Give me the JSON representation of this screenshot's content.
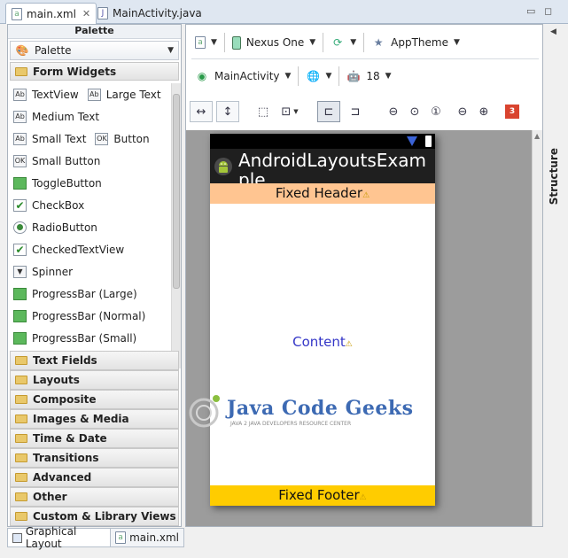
{
  "editor_tabs": [
    {
      "label": "main.xml",
      "active": true
    },
    {
      "label": "MainActivity.java",
      "active": false
    }
  ],
  "palette": {
    "header": "Palette",
    "selector": "Palette",
    "open_category": "Form Widgets",
    "widgets": [
      [
        "TextView",
        "Large Text"
      ],
      [
        "Medium Text"
      ],
      [
        "Small Text",
        "Button"
      ],
      [
        "Small Button"
      ],
      [
        "ToggleButton"
      ],
      [
        "CheckBox"
      ],
      [
        "RadioButton"
      ],
      [
        "CheckedTextView"
      ],
      [
        "Spinner"
      ],
      [
        "ProgressBar (Large)"
      ],
      [
        "ProgressBar (Normal)"
      ],
      [
        "ProgressBar (Small)"
      ]
    ],
    "categories": [
      "Text Fields",
      "Layouts",
      "Composite",
      "Images & Media",
      "Time & Date",
      "Transitions",
      "Advanced",
      "Other",
      "Custom & Library Views"
    ]
  },
  "bottom_tabs": [
    "Graphical Layout",
    "main.xml"
  ],
  "toolbar": {
    "device": "Nexus One",
    "theme": "AppTheme",
    "activity": "MainActivity",
    "api_level": "18",
    "error_count": "3"
  },
  "preview": {
    "app_title": "AndroidLayoutsExample",
    "fixed_header": "Fixed Header",
    "content": "Content",
    "fixed_footer": "Fixed Footer"
  },
  "structure_label": "Structure",
  "watermark": {
    "brand": "Java Code Geeks",
    "tagline": "JAVA 2 JAVA DEVELOPERS RESOURCE CENTER"
  }
}
